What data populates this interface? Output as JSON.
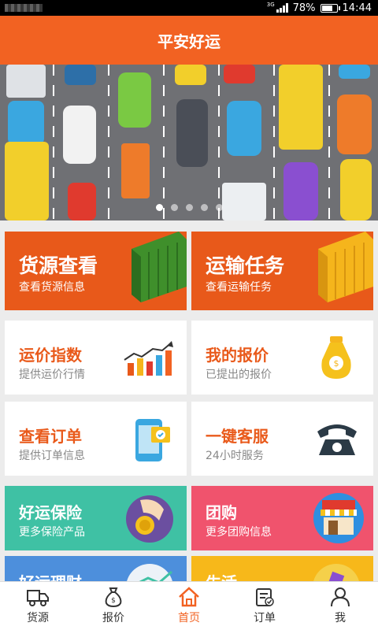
{
  "status_bar": {
    "network": "3G",
    "battery": "78%",
    "time": "14:44",
    "battery_level": 0.78
  },
  "app": {
    "title": "平安好运",
    "accent": "#f26222"
  },
  "banner": {
    "slides": 5,
    "active_slide": 1
  },
  "tiles": [
    {
      "title": "货源查看",
      "subtitle": "查看货源信息",
      "icon": "container-icon"
    },
    {
      "title": "运输任务",
      "subtitle": "查看运输任务",
      "icon": "container-icon"
    },
    {
      "title": "运价指数",
      "subtitle": "提供运价行情",
      "icon": "bar-chart-icon"
    },
    {
      "title": "我的报价",
      "subtitle": "已提出的报价",
      "icon": "money-bag-icon"
    },
    {
      "title": "查看订单",
      "subtitle": "提供订单信息",
      "icon": "phone-order-icon"
    },
    {
      "title": "一键客服",
      "subtitle": "24小时服务",
      "icon": "telephone-icon"
    },
    {
      "title": "好运保险",
      "subtitle": "更多保险产品",
      "icon": "coin-hand-icon",
      "color": "#3fc1a4"
    },
    {
      "title": "团购",
      "subtitle": "更多团购信息",
      "icon": "store-icon",
      "color": "#f0536d"
    },
    {
      "title": "好运理财",
      "subtitle": "",
      "icon": "finance-icon",
      "color": "#4d8fdc"
    },
    {
      "title": "生活",
      "subtitle": "",
      "icon": "life-icon",
      "color": "#f7b81a"
    }
  ],
  "tabs": [
    {
      "label": "货源",
      "icon": "truck-icon"
    },
    {
      "label": "报价",
      "icon": "money-bag-icon"
    },
    {
      "label": "首页",
      "icon": "home-icon",
      "active": true
    },
    {
      "label": "订单",
      "icon": "order-icon"
    },
    {
      "label": "我",
      "icon": "user-icon"
    }
  ]
}
